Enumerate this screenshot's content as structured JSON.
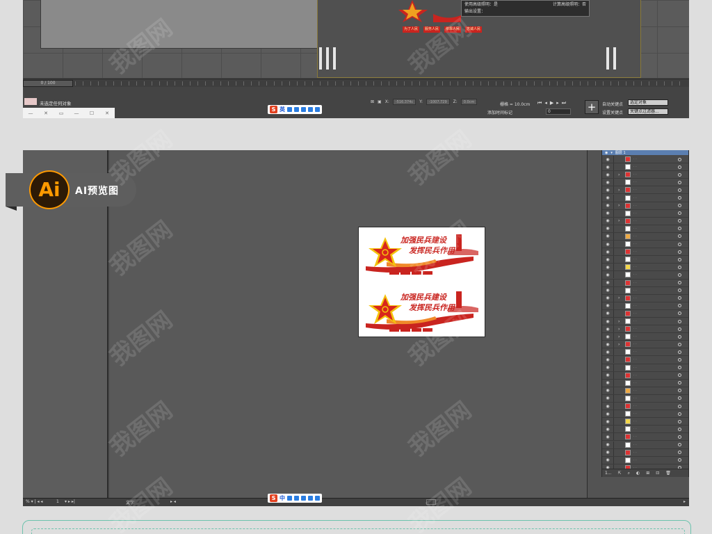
{
  "top_viewport": {
    "dialog": {
      "line1_left": "使用高级照明：是",
      "line1_right": "计算高级照明：否",
      "line2": "输出设置："
    },
    "red_tags": [
      "为了人民",
      "服务人民",
      "依靠人民",
      "忠诚人民"
    ],
    "time_slider": "0 / 100",
    "status_text": "未选定任何对象",
    "coord_x_label": "X:",
    "coord_x": "-516.374c",
    "coord_y_label": "Y:",
    "coord_y": "-1007.729",
    "coord_z_label": "Z:",
    "coord_z": "0.0cm",
    "grid_label": "栅格 = 10.0cm",
    "add_time_tag": "添加时间标记",
    "auto_key": "自动关键点",
    "set_key": "设置关键点",
    "selection_dropdown": "选定对象",
    "key_filter": "关键点过滤器...",
    "frame_value": "0",
    "ime_lang": "英"
  },
  "ai_preview": {
    "badge_logo": "Ai",
    "badge_label": "AI预览图",
    "layer_header": "图层 1",
    "layer_count_label": "1...",
    "bottom_zoom": "1",
    "bottom_tool": "文字",
    "ime_lang": "中",
    "artwork": {
      "title_top": "加强民兵建设",
      "title_bottom": "发挥民兵作用",
      "tags": [
        "听党指挥",
        "能打胜仗",
        "作风优良",
        "服务人民"
      ]
    }
  },
  "watermark_text": "我图网",
  "colors": {
    "accent_red": "#c9241f",
    "ai_orange": "#ff9a00",
    "layer_header": "#5b7fb1",
    "green_frame": "#6cc3ad"
  }
}
